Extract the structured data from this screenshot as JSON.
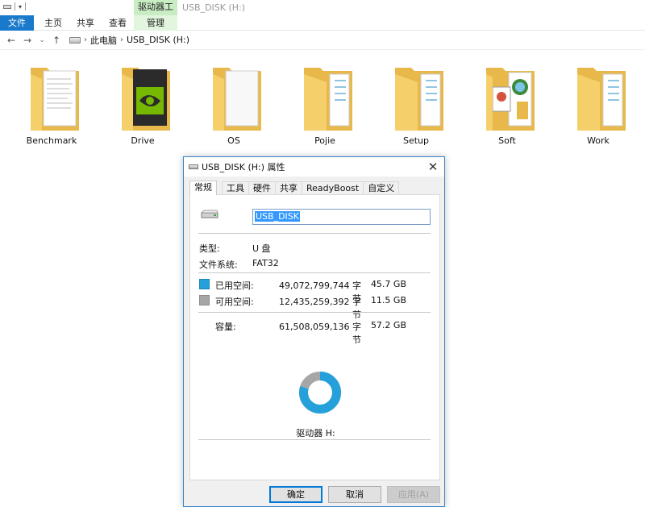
{
  "ribbon": {
    "context_header": "驱动器工具",
    "window_title": "USB_DISK (H:)",
    "tabs": [
      "文件",
      "主页",
      "共享",
      "查看"
    ],
    "context_tab": "管理"
  },
  "address": {
    "breadcrumb": [
      "此电脑",
      "USB_DISK (H:)"
    ]
  },
  "folders": [
    {
      "name": "Benchmark",
      "icon": "folder-document-icon"
    },
    {
      "name": "Drive",
      "icon": "folder-nvidia-icon"
    },
    {
      "name": "OS",
      "icon": "folder-blank-document-icon"
    },
    {
      "name": "Pojie",
      "icon": "folder-document-icon"
    },
    {
      "name": "Setup",
      "icon": "folder-document-icon"
    },
    {
      "name": "Soft",
      "icon": "folder-image-icon"
    },
    {
      "name": "Work",
      "icon": "folder-document-icon"
    }
  ],
  "dialog": {
    "title": "USB_DISK (H:) 属性",
    "tabs": [
      "常规",
      "工具",
      "硬件",
      "共享",
      "ReadyBoost",
      "自定义"
    ],
    "drive_name": "USB_DISK",
    "type_label": "类型:",
    "type_value": "U 盘",
    "fs_label": "文件系统:",
    "fs_value": "FAT32",
    "used_label": "已用空间:",
    "used_bytes": "49,072,799,744 字节",
    "used_size": "45.7 GB",
    "free_label": "可用空间:",
    "free_bytes": "12,435,259,392 字节",
    "free_size": "11.5 GB",
    "capacity_label": "容量:",
    "capacity_bytes": "61,508,059,136 字节",
    "capacity_size": "57.2 GB",
    "used_fraction": 0.798,
    "drive_label": "驱动器 H:",
    "buttons": {
      "ok": "确定",
      "cancel": "取消",
      "apply": "应用(A)"
    },
    "colors": {
      "used": "#26a0da",
      "free": "#a6a6a6",
      "accent": "#3a83c7"
    }
  }
}
